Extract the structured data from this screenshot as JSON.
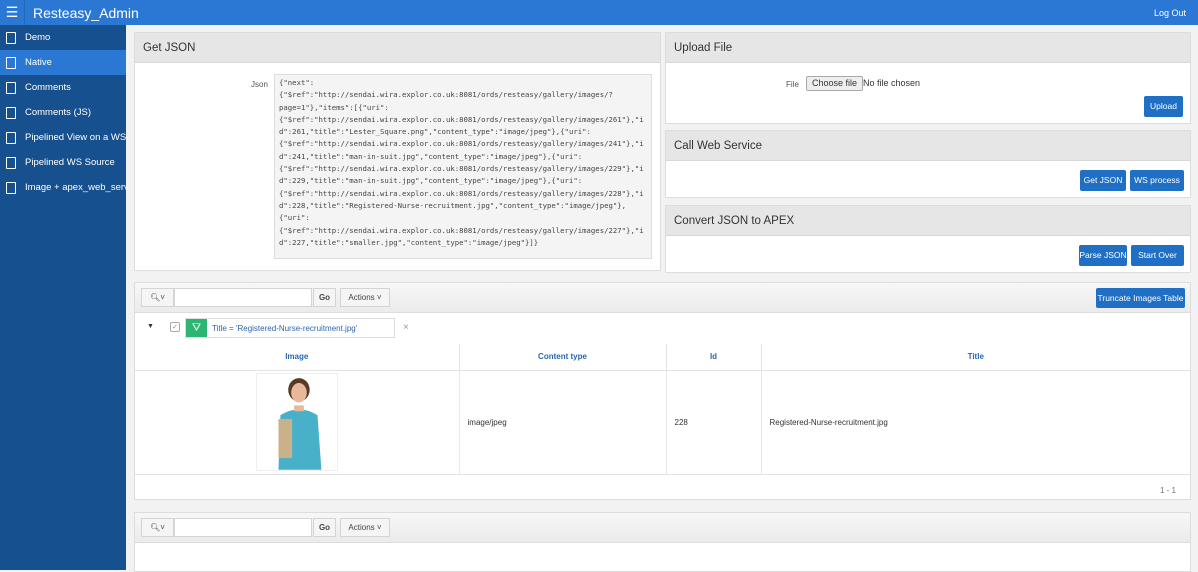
{
  "header": {
    "app_title": "Resteasy_Admin",
    "logout": "Log Out"
  },
  "sidebar": {
    "items": [
      {
        "label": "Demo"
      },
      {
        "label": "Native"
      },
      {
        "label": "Comments"
      },
      {
        "label": "Comments (JS)"
      },
      {
        "label": "Pipelined View on a WS ..."
      },
      {
        "label": "Pipelined WS Source"
      },
      {
        "label": "Image + apex_web_servi..."
      }
    ]
  },
  "get_json": {
    "title": "Get JSON",
    "json_label": "Json",
    "json_value": "{\"next\":{\"$ref\":\"http://sendai.wira.explor.co.uk:8081/ords/resteasy/gallery/images/?page=1\"},\"items\":[{\"uri\":{\"$ref\":\"http://sendai.wira.explor.co.uk:8081/ords/resteasy/gallery/images/261\"},\"id\":261,\"title\":\"Lester_Square.png\",\"content_type\":\"image/jpeg\"},{\"uri\":{\"$ref\":\"http://sendai.wira.explor.co.uk:8081/ords/resteasy/gallery/images/241\"},\"id\":241,\"title\":\"man-in-suit.jpg\",\"content_type\":\"image/jpeg\"},{\"uri\":{\"$ref\":\"http://sendai.wira.explor.co.uk:8081/ords/resteasy/gallery/images/229\"},\"id\":229,\"title\":\"man-in-suit.jpg\",\"content_type\":\"image/jpeg\"},{\"uri\":{\"$ref\":\"http://sendai.wira.explor.co.uk:8081/ords/resteasy/gallery/images/228\"},\"id\":228,\"title\":\"Registered-Nurse-recruitment.jpg\",\"content_type\":\"image/jpeg\"},{\"uri\":{\"$ref\":\"http://sendai.wira.explor.co.uk:8081/ords/resteasy/gallery/images/227\"},\"id\":227,\"title\":\"smaller.jpg\",\"content_type\":\"image/jpeg\"}]}"
  },
  "upload": {
    "title": "Upload File",
    "file_label": "File",
    "choose": "Choose file",
    "no_file": "No file chosen",
    "upload_btn": "Upload"
  },
  "call_ws": {
    "title": "Call Web Service",
    "get_json_btn": "Get JSON",
    "ws_process_btn": "WS process"
  },
  "convert": {
    "title": "Convert JSON to APEX",
    "parse_btn": "Parse JSON",
    "start_over_btn": "Start Over"
  },
  "report": {
    "go": "Go",
    "actions": "Actions",
    "truncate_btn": "Truncate Images Table",
    "filter": "Title = 'Registered-Nurse-recruitment.jpg'",
    "columns": [
      "Image",
      "Content type",
      "Id",
      "Title"
    ],
    "rows": [
      {
        "content_type": "image/jpeg",
        "id": "228",
        "title": "Registered-Nurse-recruitment.jpg"
      }
    ],
    "pagination": "1 - 1"
  },
  "report2": {
    "go": "Go",
    "actions": "Actions"
  }
}
